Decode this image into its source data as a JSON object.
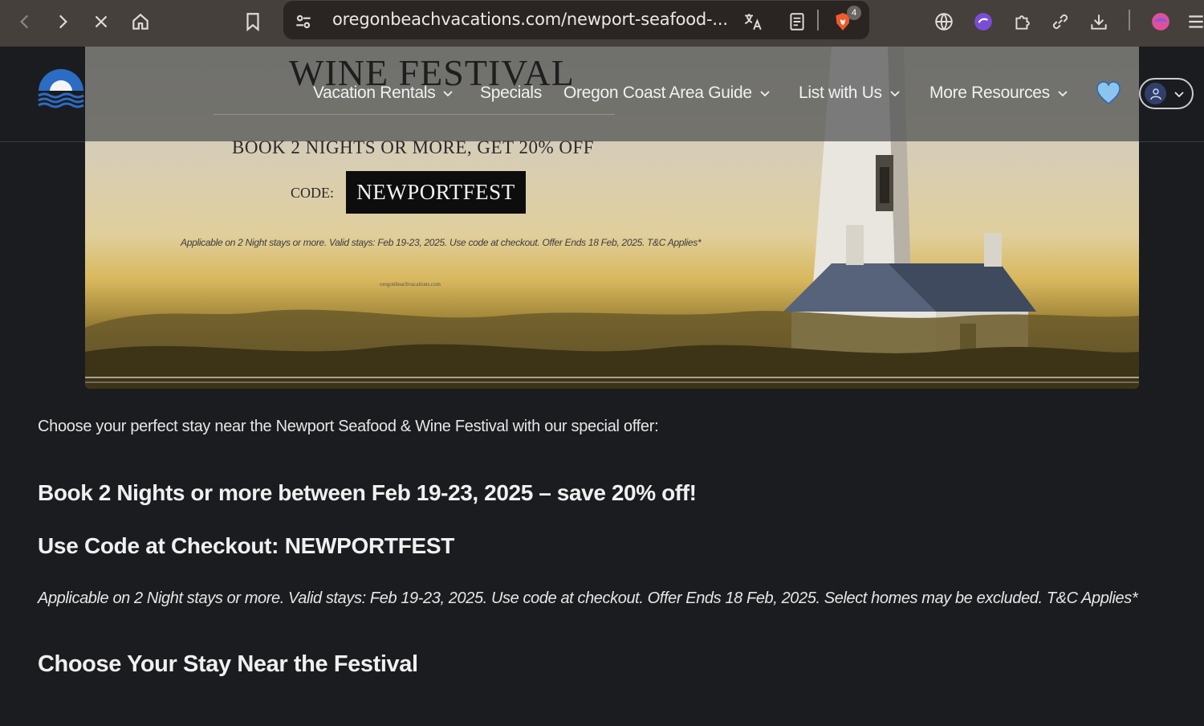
{
  "browser": {
    "url": "oregonbeachvacations.com/newport-seafood-...",
    "shield_count": "4"
  },
  "nav": {
    "items": [
      {
        "label": "Vacation Rentals",
        "has_dropdown": true
      },
      {
        "label": "Specials",
        "has_dropdown": false
      },
      {
        "label": "Oregon Coast Area Guide",
        "has_dropdown": true
      },
      {
        "label": "List with Us",
        "has_dropdown": true
      },
      {
        "label": "More Resources",
        "has_dropdown": true
      }
    ]
  },
  "hero": {
    "title": "WINE FESTIVAL",
    "subtitle": "BOOK 2 NIGHTS OR MORE, GET 20% OFF",
    "code_label": "CODE:",
    "code": "NEWPORTFEST",
    "fine_print": "Applicable on 2 Night stays or more. Valid stays: Feb 19-23, 2025. Use code at checkout. Offer Ends 18 Feb, 2025. T&C Applies*",
    "site": "oregonbeachvacations.com"
  },
  "content": {
    "intro": "Choose your perfect stay near the Newport Seafood & Wine Festival with our special offer:",
    "offer_heading": "Book 2 Nights or more between Feb 19-23, 2025 – save 20% off!",
    "code_prefix": "Use Code at Checkout: ",
    "code_value": "NEWPORTFEST",
    "fine_print": "Applicable on 2 Night stays or more. Valid stays: Feb 19-23, 2025. Use code at checkout. Offer Ends 18 Feb, 2025. Select homes may be excluded. T&C Applies*",
    "stay_heading": "Choose Your Stay Near the Festival"
  },
  "colors": {
    "page_bg": "#1b1c1f",
    "browser_bar": "#46403d",
    "heart": "#8cc4f0",
    "brave": "#f25a29",
    "extension_purple": "#7b4dd6"
  }
}
